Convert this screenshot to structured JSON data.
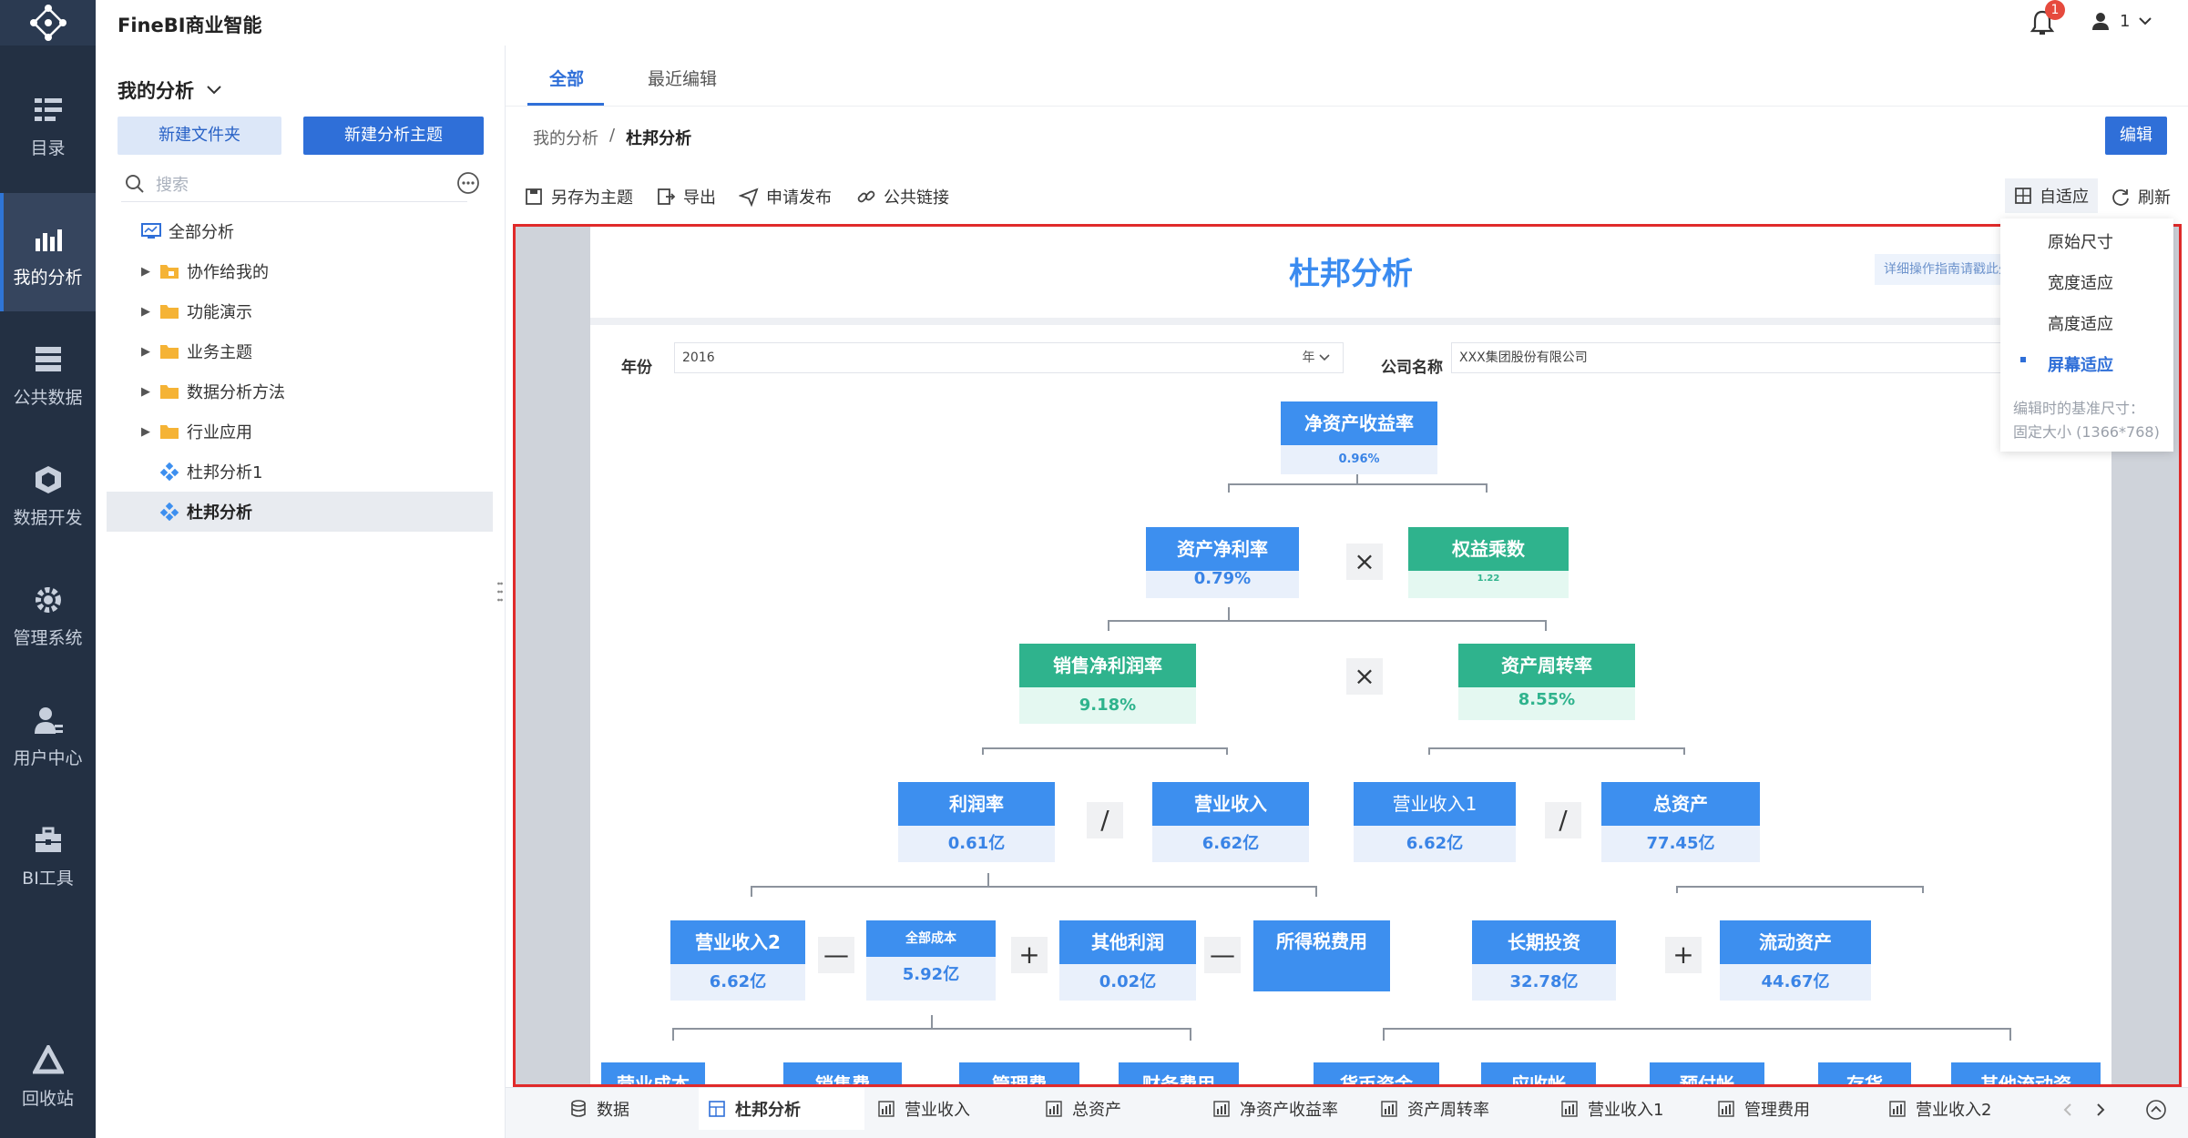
{
  "app": {
    "title": "FineBI商业智能",
    "notifications": "1",
    "user": "1"
  },
  "colors": {
    "rail": "#233043",
    "accent": "#2f6fd8",
    "node_blue": "#3d8fef",
    "node_green": "#2fb38d",
    "highlight_border": "#e02a2a"
  },
  "rail": [
    {
      "label": "目录",
      "icon": "catalog-icon"
    },
    {
      "label": "我的分析",
      "icon": "chart-icon"
    },
    {
      "label": "公共数据",
      "icon": "database-icon"
    },
    {
      "label": "数据开发",
      "icon": "cube-icon"
    },
    {
      "label": "管理系统",
      "icon": "gear-icon"
    },
    {
      "label": "用户中心",
      "icon": "user-icon"
    },
    {
      "label": "BI工具",
      "icon": "toolbox-icon"
    },
    {
      "label": "回收站",
      "icon": "recycle-icon"
    }
  ],
  "sidebar": {
    "title": "我的分析",
    "new_folder": "新建文件夹",
    "new_subject": "新建分析主题",
    "search_placeholder": "搜索",
    "tree": [
      {
        "label": "全部分析"
      },
      {
        "label": "协作给我的"
      },
      {
        "label": "功能演示"
      },
      {
        "label": "业务主题"
      },
      {
        "label": "数据分析方法"
      },
      {
        "label": "行业应用"
      },
      {
        "label": "杜邦分析1"
      },
      {
        "label": "杜邦分析"
      }
    ]
  },
  "main": {
    "tabs": [
      "全部",
      "最近编辑"
    ],
    "breadcrumb": [
      "我的分析",
      "/",
      "杜邦分析"
    ],
    "edit": "编辑",
    "toolbar": [
      "另存为主题",
      "导出",
      "申请发布",
      "公共链接"
    ],
    "fit": "自适应",
    "refresh": "刷新"
  },
  "dashboard": {
    "title": "杜邦分析",
    "guide": "详细操作指南请戳此处",
    "filters": {
      "year_label": "年份",
      "year_value": "2016",
      "year_suffix": "年",
      "company_label": "公司名称",
      "company_value": "XXX集团股份有限公司"
    },
    "nodes": {
      "roe": {
        "title": "净资产收益率",
        "value": "0.96%"
      },
      "roa": {
        "title": "资产净利率",
        "value": "0.79%"
      },
      "em": {
        "title": "权益乘数",
        "value": "1.22"
      },
      "npm": {
        "title": "销售净利润率",
        "value": "9.18%"
      },
      "tat": {
        "title": "资产周转率",
        "value": "8.55%"
      },
      "profit": {
        "title": "利润率",
        "value": "0.61亿"
      },
      "rev": {
        "title": "营业收入",
        "value": "6.62亿"
      },
      "rev1": {
        "title": "营业收入1",
        "value": "6.62亿"
      },
      "assets": {
        "title": "总资产",
        "value": "77.45亿"
      },
      "rev2": {
        "title": "营业收入2",
        "value": "6.62亿"
      },
      "cost": {
        "title": "全部成本",
        "value": "5.92亿"
      },
      "other": {
        "title": "其他利润",
        "value": "0.02亿"
      },
      "tax": {
        "title": "所得税费用",
        "value": ""
      },
      "lti": {
        "title": "长期投资",
        "value": "32.78亿"
      },
      "ca": {
        "title": "流动资产",
        "value": "44.67亿"
      },
      "b1": {
        "title": "营业成本"
      },
      "b2": {
        "title": "销售费"
      },
      "b3": {
        "title": "管理费"
      },
      "b4": {
        "title": "财务费用"
      },
      "b5": {
        "title": "货币资金"
      },
      "b6": {
        "title": "应收帐"
      },
      "b7": {
        "title": "预付帐"
      },
      "b8": {
        "title": "存货"
      },
      "b9": {
        "title": "其他流动资"
      }
    },
    "ops": {
      "times": "×",
      "divide": "/",
      "minus": "—",
      "plus": "+"
    }
  },
  "fit_menu": {
    "items": [
      "原始尺寸",
      "宽度适应",
      "高度适应",
      "屏幕适应"
    ],
    "selected": "屏幕适应",
    "note1": "编辑时的基准尺寸：",
    "note2": "固定大小 (1366*768)"
  },
  "bottom_tabs": [
    "数据",
    "杜邦分析",
    "营业收入",
    "总资产",
    "净资产收益率",
    "资产周转率",
    "营业收入1",
    "管理费用",
    "营业收入2"
  ]
}
